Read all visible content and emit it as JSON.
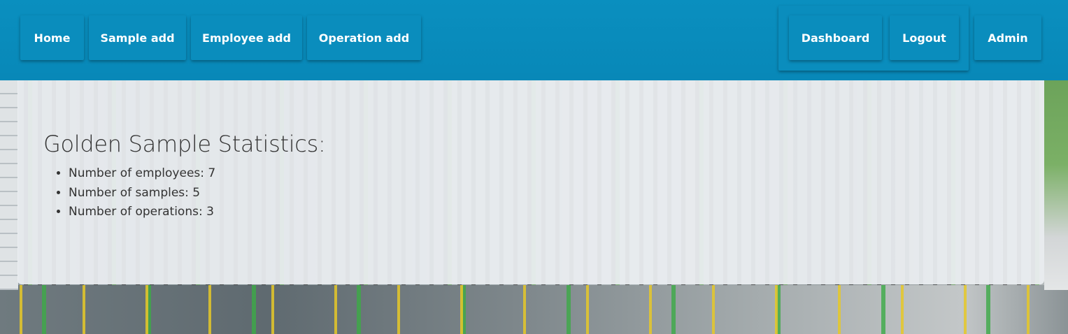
{
  "nav": {
    "left_items": [
      {
        "label": "Home"
      },
      {
        "label": "Sample add"
      },
      {
        "label": "Employee add"
      },
      {
        "label": "Operation add"
      }
    ],
    "right_items": [
      {
        "label": "Dashboard"
      },
      {
        "label": "Logout"
      },
      {
        "label": "Admin"
      }
    ]
  },
  "main": {
    "title": "Golden Sample Statistics:",
    "stats": [
      {
        "text": "Number of employees: 7"
      },
      {
        "text": "Number of samples: 5"
      },
      {
        "text": "Number of operations: 3"
      }
    ]
  },
  "colors": {
    "navbar": "#0a8fbf",
    "button": "#0a8dbd",
    "panel": "#eceff2"
  }
}
